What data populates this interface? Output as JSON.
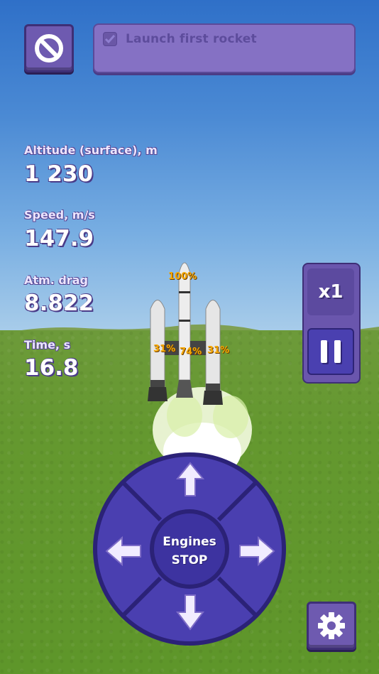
{
  "mission": {
    "task_label": "Launch first rocket",
    "task_done": true
  },
  "telemetry": [
    {
      "label": "Altitude (surface), m",
      "value": "1 230"
    },
    {
      "label": "Speed, m/s",
      "value": "147.9"
    },
    {
      "label": "Atm. drag",
      "value": "8.822"
    },
    {
      "label": "Time, s",
      "value": "16.8"
    }
  ],
  "engines": {
    "center": "100%",
    "left": "31%",
    "middle": "74%",
    "right": "31%"
  },
  "time_controls": {
    "speed_label": "x1"
  },
  "joystick": {
    "center_line1": "Engines",
    "center_line2": "STOP"
  },
  "icons": {
    "cancel": "no-entry-icon",
    "pause": "pause-icon",
    "settings": "gear-icon",
    "up": "arrow-up-icon",
    "down": "arrow-down-icon",
    "left": "arrow-left-icon",
    "right": "arrow-right-icon"
  },
  "colors": {
    "accent": "#4a3fb0",
    "panel": "#6e5ab0",
    "engine_text": "#f7a800"
  }
}
